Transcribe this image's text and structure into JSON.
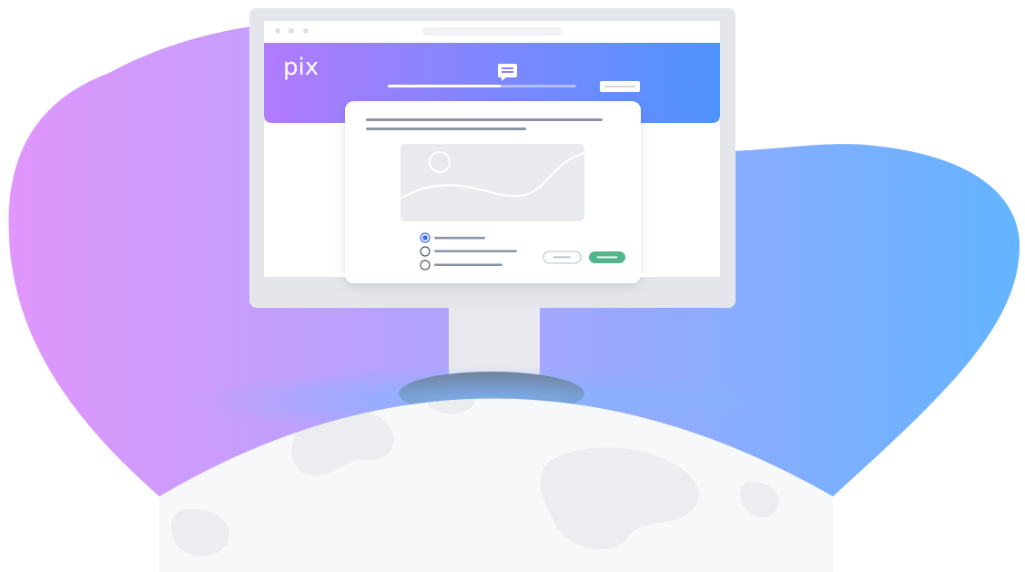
{
  "brand": {
    "name": "pix"
  },
  "colors": {
    "blob_left": "#E096FC",
    "blob_right": "#63B4FF",
    "header_left": "#B07BFD",
    "header_right": "#4E93FF",
    "monitor_frame": "#E4E6EC",
    "monitor_stand": "#E8EAF0",
    "monitor_base": "#6E7A8C",
    "globe": "#F7F8FA",
    "globe_land": "#EBEDF0",
    "accent_green": "#52B58B",
    "radio_blue": "#3D68FF",
    "line_gray": "#8A93A6"
  },
  "icons": {
    "chat": "chat-bubble-icon",
    "image_placeholder": "image-placeholder-icon",
    "window_controls": "window-dots-icon"
  },
  "progress": {
    "value": 0.6
  },
  "question": {
    "options": [
      {
        "selected": true
      },
      {
        "selected": false
      },
      {
        "selected": false
      }
    ]
  }
}
